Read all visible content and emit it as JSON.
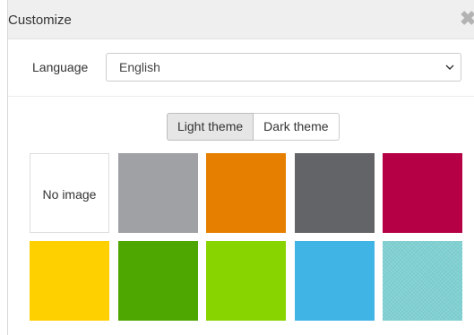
{
  "dialog": {
    "title": "Customize",
    "close_icon": "close-icon"
  },
  "language": {
    "label": "Language",
    "selected": "English",
    "dropdown_icon": "chevron-down-icon"
  },
  "theme_toggle": {
    "options": [
      {
        "label": "Light theme",
        "active": true
      },
      {
        "label": "Dark theme",
        "active": false
      }
    ]
  },
  "backgrounds": [
    {
      "name": "no-image",
      "label": "No image",
      "color": "#ffffff"
    },
    {
      "name": "gray",
      "color": "#a0a1a5"
    },
    {
      "name": "orange",
      "color": "#e67e00"
    },
    {
      "name": "dark-gray",
      "color": "#636468"
    },
    {
      "name": "crimson",
      "color": "#b50045"
    },
    {
      "name": "yellow",
      "color": "#ffd000"
    },
    {
      "name": "green",
      "color": "#4ea600"
    },
    {
      "name": "lime",
      "color": "#88d400"
    },
    {
      "name": "sky-blue",
      "color": "#41b4e6"
    },
    {
      "name": "teal-texture",
      "color": "#7fd1d3"
    }
  ]
}
